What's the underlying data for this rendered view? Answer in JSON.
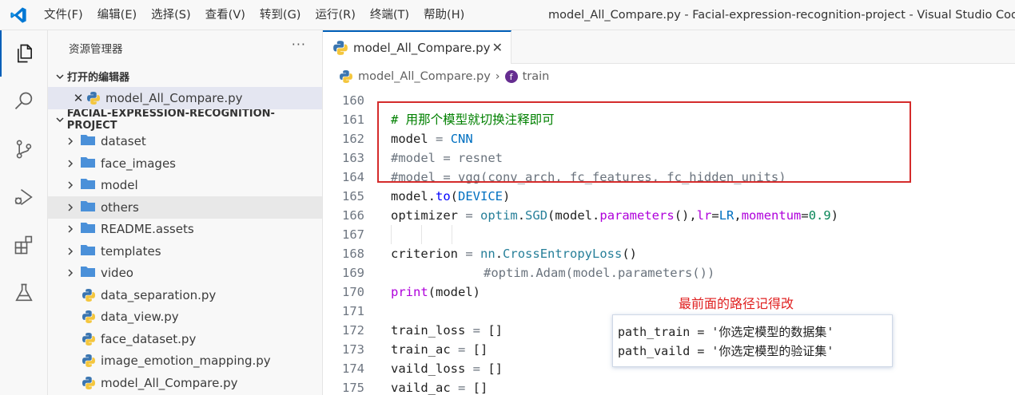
{
  "titlebar": {
    "menus": [
      "文件(F)",
      "编辑(E)",
      "选择(S)",
      "查看(V)",
      "转到(G)",
      "运行(R)",
      "终端(T)",
      "帮助(H)"
    ],
    "window_title": "model_All_Compare.py - Facial-expression-recognition-project - Visual Studio Code"
  },
  "activitybar": {
    "items": [
      "explorer-icon",
      "search-icon",
      "source-control-icon",
      "run-debug-icon",
      "extensions-icon",
      "testing-icon"
    ]
  },
  "sidebar": {
    "title": "资源管理器",
    "more": "···",
    "open_editors": {
      "title": "打开的编辑器",
      "files": [
        "model_All_Compare.py"
      ]
    },
    "project": {
      "title": "FACIAL-EXPRESSION-RECOGNITION-PROJECT",
      "folders": [
        "dataset",
        "face_images",
        "model",
        "others",
        "README.assets",
        "templates",
        "video"
      ],
      "files": [
        "data_separation.py",
        "data_view.py",
        "face_dataset.py",
        "image_emotion_mapping.py",
        "model_All_Compare.py"
      ]
    }
  },
  "editor": {
    "tab_label": "model_All_Compare.py",
    "breadcrumb": {
      "file": "model_All_Compare.py",
      "symbol": "train",
      "symbol_badge": "f"
    },
    "line_numbers": [
      "160",
      "161",
      "162",
      "163",
      "164",
      "165",
      "166",
      "167",
      "168",
      "169",
      "170",
      "171",
      "172",
      "173",
      "174",
      "175"
    ]
  },
  "annotations": {
    "red_note": "最前面的路径记得改",
    "box_lines": [
      "path_train = '你选定模型的数据集'",
      "path_vaild = '你选定模型的验证集'"
    ]
  },
  "colors": {
    "accent": "#005fb8",
    "highlight_box": "#d42b2b",
    "comment": "#008000"
  }
}
